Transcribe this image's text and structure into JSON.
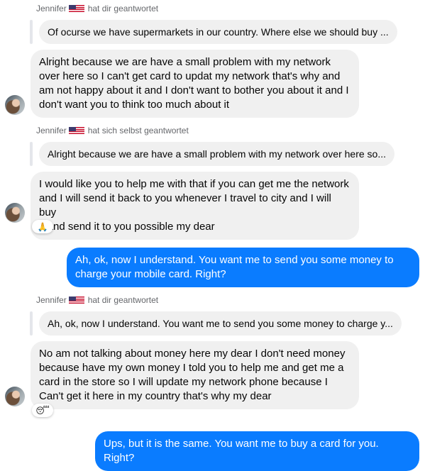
{
  "messages": {
    "reply1": {
      "sender": "Jennifer",
      "action": "hat dir geantwortet",
      "quote": "Of ocurse we have supermarkets in our country. Where else we should buy ..."
    },
    "in1": {
      "lines": [
        "Alright because we are have a small problem with my network",
        "over here so I can't get card to updat my network that's why and",
        "am not happy about it and I don't want to bother you about it and I",
        "don't want you to think too much about it"
      ]
    },
    "reply2": {
      "sender": "Jennifer",
      "action": "hat sich selbst geantwortet",
      "quote": "Alright because we are have a small problem with my network over here so..."
    },
    "in2": {
      "lines": [
        "I would like you to help me with that if you can get me the network",
        "and I will send it back to you whenever I travel to city and I will buy",
        "it and send it to you possible my dear"
      ],
      "reaction": "🙏"
    },
    "out1": {
      "lines": [
        "Ah, ok, now I understand. You want me to send you some money to",
        "charge your mobile card. Right?"
      ]
    },
    "reply3": {
      "sender": "Jennifer",
      "action": "hat dir geantwortet",
      "quote": "Ah, ok, now I understand. You want me to send you some money to charge y..."
    },
    "in3": {
      "lines": [
        "No am not talking about money here my dear I don't need money",
        "because have my own money I told you to help me and get me a",
        "card in the store so I will update my network phone because I",
        "Can't get it here in my country that's why my dear"
      ],
      "reaction": "😴"
    },
    "out2": {
      "lines": [
        "Ups, but it is the same. You want me to buy a card for you. Right?"
      ]
    }
  },
  "colors": {
    "outgoing": "#0a7cff",
    "incoming": "#f0f0f0",
    "meta": "#65676b"
  },
  "icons": {
    "flag": "us-flag-icon",
    "avatar": "contact-avatar"
  }
}
